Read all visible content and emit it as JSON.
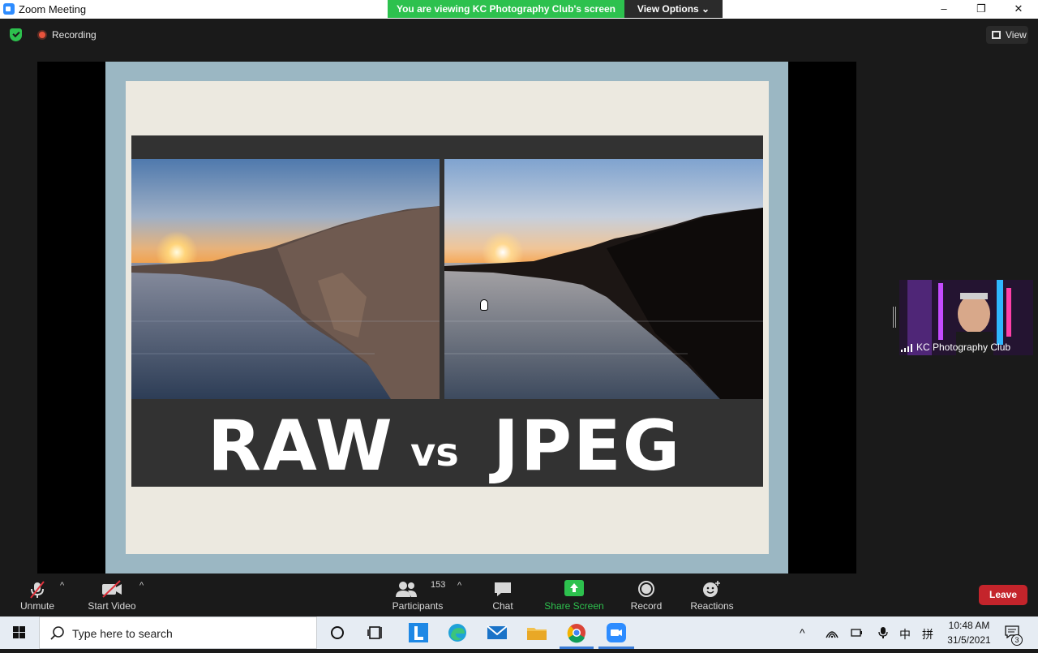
{
  "window": {
    "title": "Zoom Meeting",
    "minimize": "–",
    "maximize": "❐",
    "close": "✕"
  },
  "share_banner": "You are viewing KC Photography Club's screen",
  "view_options": "View Options ⌄",
  "status": {
    "recording": "Recording",
    "view": "View"
  },
  "slide": {
    "left_word": "RAW",
    "vs_word": "vs",
    "right_word": "JPEG"
  },
  "participant": {
    "name": "KC Photography Club"
  },
  "toolbar": {
    "unmute": "Unmute",
    "start_video": "Start Video",
    "participants": "Participants",
    "participants_count": "153",
    "chat": "Chat",
    "share_screen": "Share Screen",
    "record": "Record",
    "reactions": "Reactions",
    "leave": "Leave"
  },
  "taskbar": {
    "search_placeholder": "Type here to search",
    "time": "10:48 AM",
    "date": "31/5/2021",
    "notifications": "3",
    "ime_label": "中",
    "ime_mode": "拼"
  },
  "colors": {
    "zoom_blue": "#2d8cff",
    "share_green": "#2dc14e",
    "leave_red": "#c4242b",
    "toolbar_bg": "#1a1a1a"
  }
}
